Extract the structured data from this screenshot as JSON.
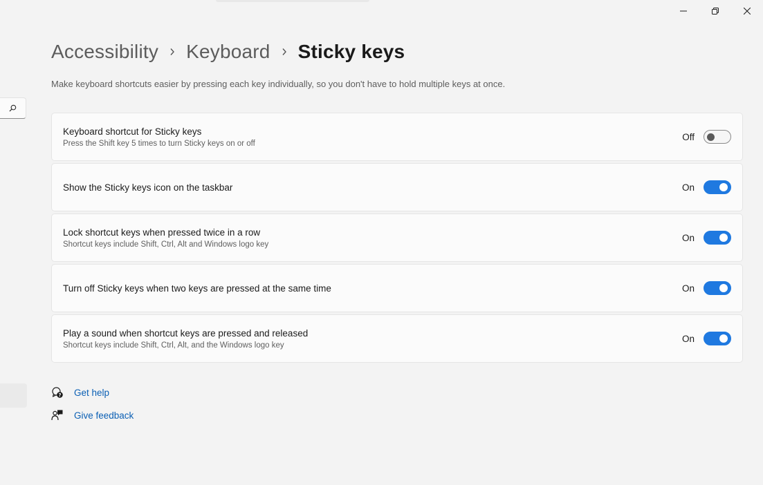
{
  "window": {
    "controls": {
      "minimize_icon": "minimize-icon",
      "restore_icon": "restore-icon",
      "close_icon": "close-icon"
    }
  },
  "sidebar": {
    "search_icon": "search-icon"
  },
  "breadcrumb": {
    "items": [
      "Accessibility",
      "Keyboard",
      "Sticky keys"
    ]
  },
  "description": "Make keyboard shortcuts easier by pressing each key individually, so you don't have to hold multiple keys at once.",
  "settings": [
    {
      "title": "Keyboard shortcut for Sticky keys",
      "subtitle": "Press the Shift key 5 times to turn Sticky keys on or off",
      "state": "Off",
      "on": false
    },
    {
      "title": "Show the Sticky keys icon on the taskbar",
      "subtitle": "",
      "state": "On",
      "on": true
    },
    {
      "title": "Lock shortcut keys when pressed twice in a row",
      "subtitle": "Shortcut keys include Shift, Ctrl, Alt and Windows logo key",
      "state": "On",
      "on": true
    },
    {
      "title": "Turn off Sticky keys when two keys are pressed at the same time",
      "subtitle": "",
      "state": "On",
      "on": true
    },
    {
      "title": "Play a sound when shortcut keys are pressed and released",
      "subtitle": "Shortcut keys include Shift, Ctrl, Alt, and the Windows logo key",
      "state": "On",
      "on": true
    }
  ],
  "links": {
    "help": "Get help",
    "feedback": "Give feedback"
  },
  "colors": {
    "accent": "#1f79e0",
    "link": "#0a5fb4",
    "background": "#f3f3f3",
    "card": "#fbfbfb"
  }
}
